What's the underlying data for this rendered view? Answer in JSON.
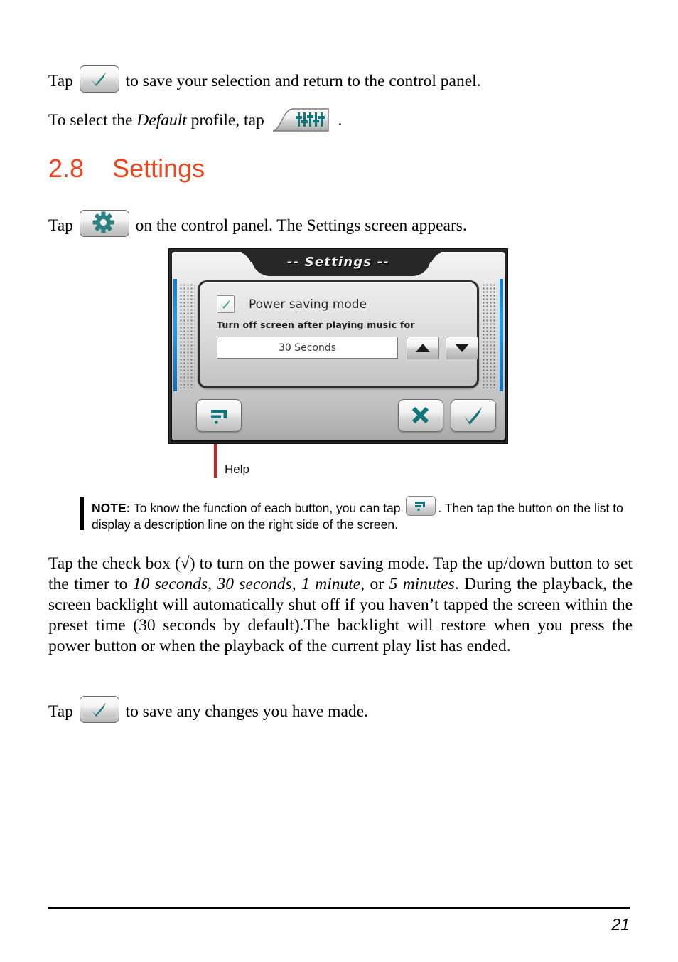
{
  "document": {
    "page_number": "21"
  },
  "intro": {
    "line1_before": "Tap",
    "line1_after": "to save your selection and return to the control panel.",
    "line2_before": "To select the",
    "line2_italic": "Default",
    "line2_mid": "profile, tap",
    "line2_after": "."
  },
  "section": {
    "number": "2.8",
    "title": "Settings",
    "heading_full": "2.8    Settings",
    "accent_color": "#ec4521",
    "intro_before": "Tap",
    "intro_after": "on the control panel. The Settings screen appears."
  },
  "device": {
    "title": "-- Settings --",
    "checkbox_label": "Power saving mode",
    "checkbox_checked": true,
    "sub_label": "Turn off screen after playing music for",
    "value": "30 Seconds",
    "spinner_up": "▲",
    "spinner_down": "▼",
    "buttons": {
      "help": "help-button",
      "cancel": "cancel-button",
      "ok": "ok-button"
    },
    "accent_blue": "#1fa0ef",
    "glyph_teal": "#11767a"
  },
  "callout": {
    "label": "Help",
    "line_color": "#e01b1b"
  },
  "note": {
    "label": "NOTE:",
    "text_part1": "To know the function of each button, you can tap",
    "text_part2": ". Then tap the button on the list to display a description line on the right side of the screen."
  },
  "body": {
    "paragraph": "Tap the check box (√) to turn on the power saving mode. Tap the up/down button to set the timer to ",
    "opt1": "10 seconds",
    "sep1": ", ",
    "opt2": "30 seconds",
    "sep2": ", ",
    "opt3": "1 minute",
    "sep3": ", or ",
    "opt4": "5 minutes",
    "paragraph_tail": ". During the playback, the screen backlight will automatically shut off if you haven’t tapped the screen within the preset time (30 seconds by default).The backlight will restore when you press the power button or when the playback of the current play list has ended.",
    "closing_before": "Tap",
    "closing_after": "to save any changes you have made."
  },
  "icons": {
    "check": "check-icon",
    "gear": "gear-icon",
    "equalizer": "equalizer-profile-icon",
    "help": "help-question-icon",
    "cross": "cross-icon"
  }
}
